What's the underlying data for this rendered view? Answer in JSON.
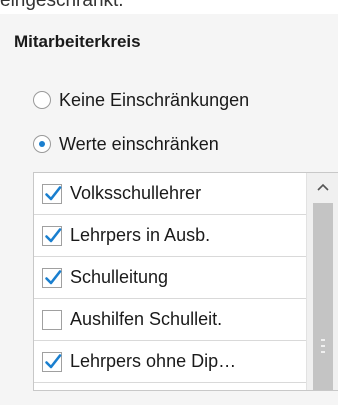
{
  "header_text": "eingeschränkt.",
  "panel": {
    "title": "Mitarbeiterkreis",
    "radio_options": [
      {
        "label": "Keine Einschränkungen",
        "selected": false
      },
      {
        "label": "Werte einschränken",
        "selected": true
      }
    ]
  },
  "list": {
    "items": [
      {
        "label": "Volksschullehrer",
        "checked": true
      },
      {
        "label": "Lehrpers in Ausb.",
        "checked": true
      },
      {
        "label": "Schulleitung",
        "checked": true
      },
      {
        "label": "Aushilfen Schulleit.",
        "checked": false
      },
      {
        "label": "Lehrpers ohne Dip…",
        "checked": true
      }
    ],
    "scroll_up_icon": "chevron-up-icon",
    "check_color": "#1a7fcf"
  }
}
